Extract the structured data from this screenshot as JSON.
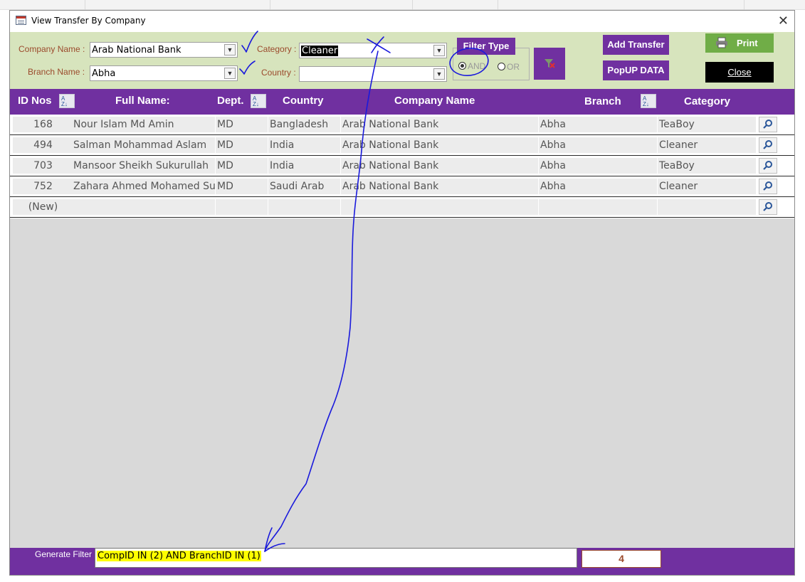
{
  "window": {
    "title": "View Transfer By Company",
    "close_glyph": "✕"
  },
  "filters": {
    "company_label": "Company Name :",
    "company_value": "Arab National Bank",
    "branch_label": "Branch Name :",
    "branch_value": "Abha",
    "category_label": "Category :",
    "category_value": "Cleaner",
    "country_label": "Country :",
    "country_value": "",
    "filter_type_label": "Filter Type",
    "and_label": "AND",
    "or_label": "OR",
    "selected": "AND"
  },
  "buttons": {
    "add_transfer": "Add Transfer",
    "popup_data": "PopUP DATA",
    "print": "Print",
    "close": "Close"
  },
  "columns": {
    "id": "ID Nos",
    "name": "Full Name:",
    "dept": "Dept.",
    "country": "Country",
    "company": "Company Name",
    "branch": "Branch",
    "category": "Category"
  },
  "rows": [
    {
      "id": "168",
      "name": "Nour Islam Md Amin",
      "dept": "MD",
      "country": "Bangladesh",
      "company": "Arab National Bank",
      "branch": "Abha",
      "category": "TeaBoy"
    },
    {
      "id": "494",
      "name": "Salman Mohammad Aslam",
      "dept": "MD",
      "country": "India",
      "company": "Arab National Bank",
      "branch": "Abha",
      "category": "Cleaner"
    },
    {
      "id": "703",
      "name": "Mansoor Sheikh Sukurullah",
      "dept": "MD",
      "country": "India",
      "company": "Arab National Bank",
      "branch": "Abha",
      "category": "TeaBoy"
    },
    {
      "id": "752",
      "name": "Zahara Ahmed Mohamed Sulta",
      "dept": "MD",
      "country": "Saudi Arab",
      "company": "Arab National Bank",
      "branch": "Abha",
      "category": "Cleaner"
    }
  ],
  "new_row_label": "(New)",
  "footer": {
    "generate_label": "Generate Filter",
    "filter_text": "CompID IN (2) AND BranchID IN (1)",
    "count": "4"
  },
  "colors": {
    "header_bg": "#d7e4bd",
    "accent_purple": "#7030a0",
    "print_green": "#70ad47",
    "label_brown": "#9b4a2c",
    "ink_blue": "#1a1adc",
    "highlight_yellow": "#ffff00"
  }
}
